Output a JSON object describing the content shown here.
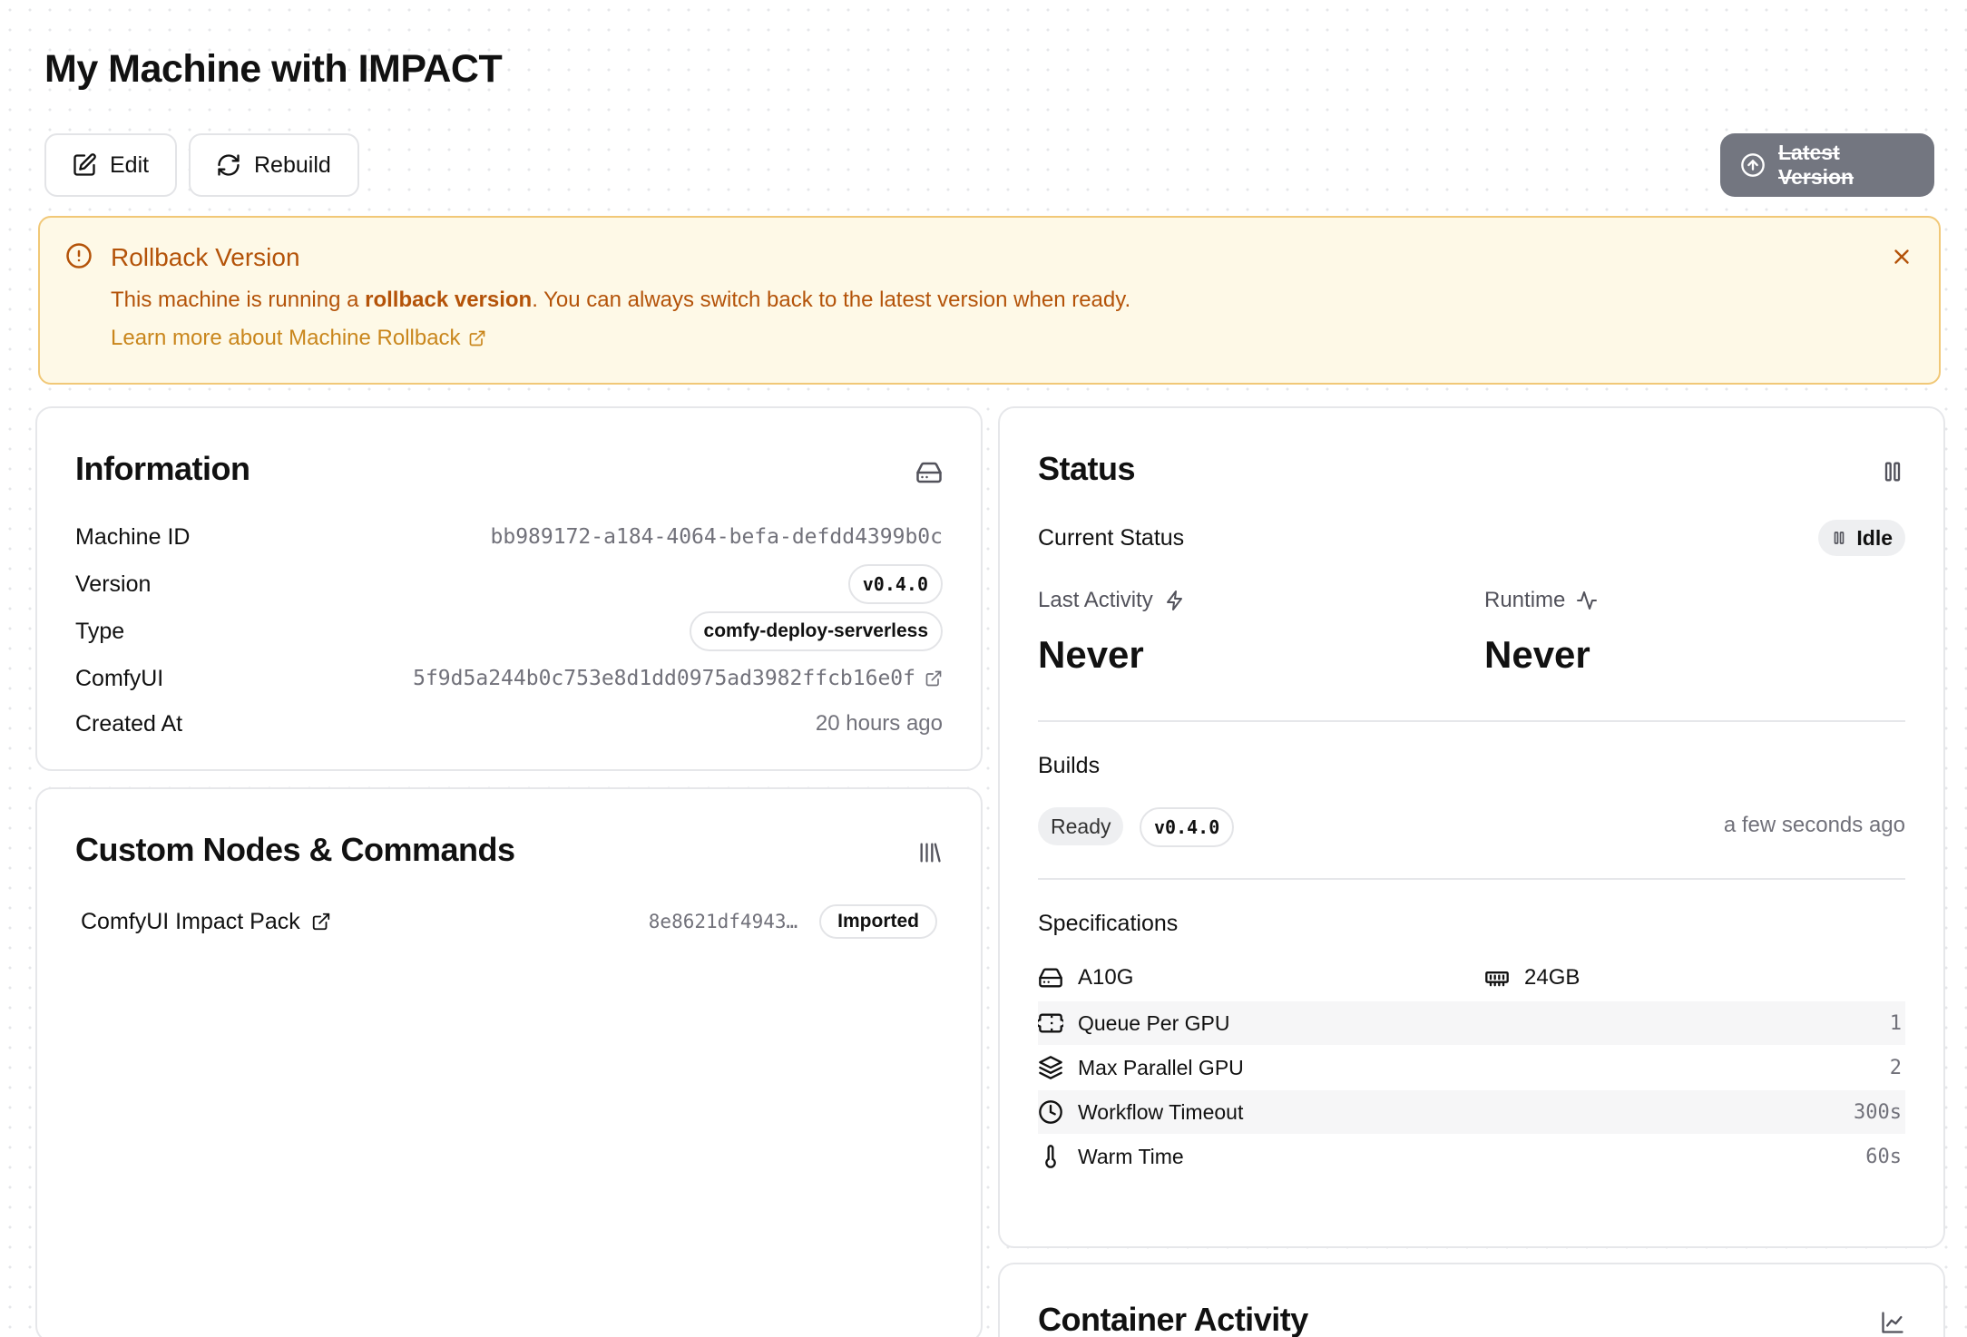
{
  "page": {
    "title": "My Machine with IMPACT"
  },
  "toolbar": {
    "edit_label": "Edit",
    "rebuild_label": "Rebuild",
    "latest_version_label": "Latest Version"
  },
  "banner": {
    "title": "Rollback Version",
    "text_prefix": "This machine is running a ",
    "text_bold": "rollback version",
    "text_suffix": ". You can always switch back to the latest version when ready.",
    "link_label": "Learn more about Machine Rollback"
  },
  "information": {
    "title": "Information",
    "rows": {
      "machine_id": {
        "label": "Machine ID",
        "value": "bb989172-a184-4064-befa-defdd4399b0c"
      },
      "version": {
        "label": "Version",
        "value": "v0.4.0"
      },
      "type": {
        "label": "Type",
        "value": "comfy-deploy-serverless"
      },
      "comfyui": {
        "label": "ComfyUI",
        "value": "5f9d5a244b0c753e8d1dd0975ad3982ffcb16e0f"
      },
      "created_at": {
        "label": "Created At",
        "value": "20 hours ago"
      }
    }
  },
  "custom_nodes": {
    "title": "Custom Nodes & Commands",
    "items": [
      {
        "name": "ComfyUI Impact Pack",
        "hash": "8e8621df4943…",
        "status": "Imported"
      }
    ]
  },
  "status": {
    "title": "Status",
    "current_status_label": "Current Status",
    "current_status_value": "Idle",
    "last_activity_label": "Last Activity",
    "last_activity_value": "Never",
    "runtime_label": "Runtime",
    "runtime_value": "Never",
    "builds_label": "Builds",
    "build_status": "Ready",
    "build_version": "v0.4.0",
    "build_time": "a few seconds ago",
    "specifications_label": "Specifications",
    "gpu": "A10G",
    "memory": "24GB",
    "specs": {
      "queue_per_gpu": {
        "label": "Queue Per GPU",
        "value": "1"
      },
      "max_parallel_gpu": {
        "label": "Max Parallel GPU",
        "value": "2"
      },
      "workflow_timeout": {
        "label": "Workflow Timeout",
        "value": "300s"
      },
      "warm_time": {
        "label": "Warm Time",
        "value": "60s"
      }
    }
  },
  "container_activity": {
    "title": "Container Activity"
  }
}
